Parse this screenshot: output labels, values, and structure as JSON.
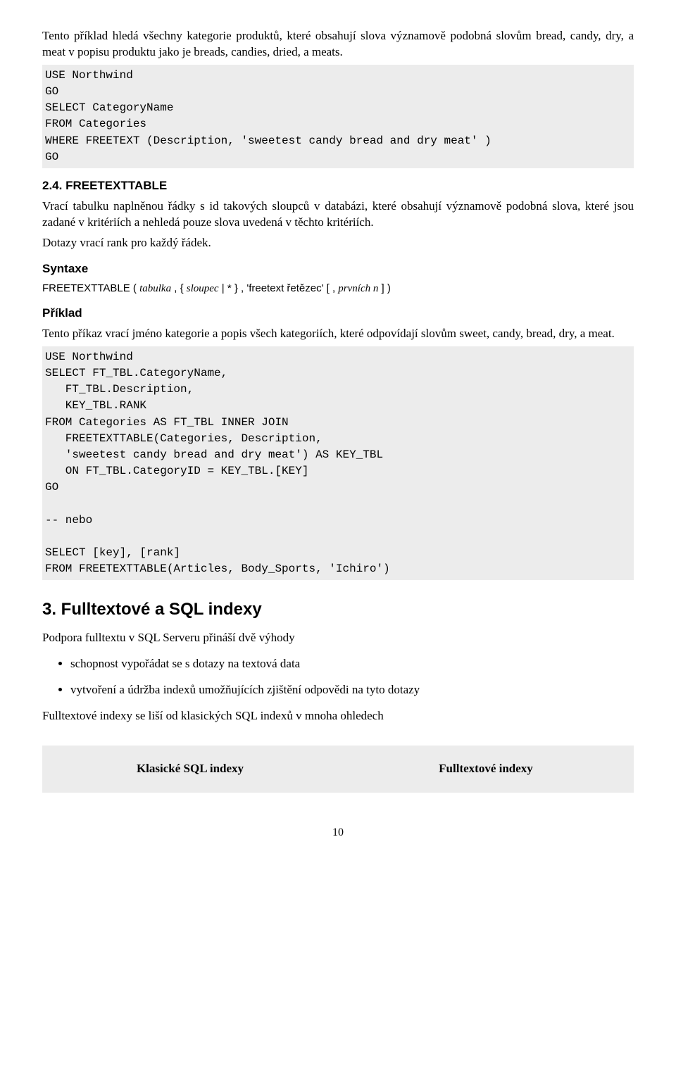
{
  "intro_p1": "Tento příklad hledá všechny kategorie produktů, které obsahují slova významově podobná slovům bread, candy, dry, a meat v popisu produktu jako je breads, candies, dried, a meats.",
  "code1": "USE Northwind\nGO\nSELECT CategoryName\nFROM Categories\nWHERE FREETEXT (Description, 'sweetest candy bread and dry meat' )\nGO",
  "h24": "2.4.    FREETEXTTABLE",
  "p24a": "Vrací tabulku naplněnou řádky s id takových sloupců v databázi, které obsahují významově podobná slova, které jsou zadané v kritériích a nehledá pouze slova uvedená v těchto kritériích.",
  "p24b": "Dotazy vrací rank pro každý řádek.",
  "syntaxe_h": "Syntaxe",
  "syntax_plain1": "FREETEXTTABLE ( ",
  "syntax_it1": "tabulka",
  "syntax_plain2": " , { ",
  "syntax_it2": "sloupec",
  "syntax_plain3": " | * } , 'freetext řetězec' [ , ",
  "syntax_it3": "prvních n",
  "syntax_plain4": " ] )",
  "priklad_h": "Příklad",
  "priklad_p": "Tento příkaz vrací jméno kategorie a popis všech kategoriích, které odpovídají slovům sweet, candy, bread, dry, a meat.",
  "code2": "USE Northwind\nSELECT FT_TBL.CategoryName,\n   FT_TBL.Description,\n   KEY_TBL.RANK\nFROM Categories AS FT_TBL INNER JOIN\n   FREETEXTTABLE(Categories, Description,\n   'sweetest candy bread and dry meat') AS KEY_TBL\n   ON FT_TBL.CategoryID = KEY_TBL.[KEY]\nGO\n\n-- nebo\n\nSELECT [key], [rank]\nFROM FREETEXTTABLE(Articles, Body_Sports, 'Ichiro')",
  "sec3_h": "3. Fulltextové a SQL indexy",
  "sec3_p": "Podpora fulltextu v SQL Serveru přináší dvě výhody",
  "bullets": {
    "b1": "schopnost vypořádat se s dotazy na textová data",
    "b2": "vytvoření a údržba indexů umožňujících zjištění odpovědi na tyto dotazy"
  },
  "sec3_p2": "Fulltextové indexy se liší od klasických SQL indexů v mnoha ohledech",
  "idx_left": "Klasické SQL indexy",
  "idx_right": "Fulltextové indexy",
  "pagenum": "10"
}
